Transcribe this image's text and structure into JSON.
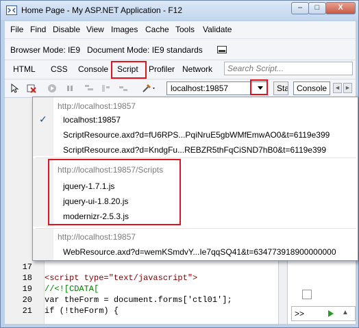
{
  "window": {
    "title": "Home Page - My ASP.NET Application - F12",
    "minimize_glyph": "–",
    "maximize_glyph": "□",
    "close_glyph": "X"
  },
  "menubar": {
    "items": [
      {
        "label": "File"
      },
      {
        "label": "Find"
      },
      {
        "label": "Disable"
      },
      {
        "label": "View"
      },
      {
        "label": "Images"
      },
      {
        "label": "Cache"
      },
      {
        "label": "Tools"
      },
      {
        "label": "Validate"
      }
    ]
  },
  "modebar": {
    "browser_mode": "Browser Mode: IE9",
    "document_mode": "Document Mode: IE9 standards"
  },
  "tabs": {
    "items": [
      {
        "label": "HTML"
      },
      {
        "label": "CSS"
      },
      {
        "label": "Console"
      },
      {
        "label": "Script"
      },
      {
        "label": "Profiler"
      },
      {
        "label": "Network"
      }
    ],
    "selected": "Script",
    "search_placeholder": "Search Script..."
  },
  "toolbar": {
    "url_value": "localhost:19857",
    "start_label": "Start",
    "console_label": "Console",
    "left_arrow": "◄",
    "right_arrow": "►"
  },
  "dropdown": {
    "groups": [
      {
        "header": "http://localhost:19857",
        "items": [
          "localhost:19857",
          "ScriptResource.axd?d=fU6RPS...PqiNruE5gbWMfEmwAO0&t=6119e399",
          "ScriptResource.axd?d=KndgFu...REBZR5thFqCiSND7hB0&t=6119e399"
        ]
      },
      {
        "header": "http://localhost:19857/Scripts",
        "items": [
          "jquery-1.7.1.js",
          "jquery-ui-1.8.20.js",
          "modernizr-2.5.3.js"
        ]
      },
      {
        "header": "http://localhost:19857",
        "items": [
          "WebResource.axd?d=wemKSmdvY...Ie7qqSQ41&t=634773918900000000"
        ]
      }
    ],
    "checked_item": "localhost:19857"
  },
  "code": {
    "lines": [
      {
        "num": "17",
        "text": ""
      },
      {
        "num": "18",
        "text": "<script type=\"text/javascript\">"
      },
      {
        "num": "19",
        "text": "//<![CDATA["
      },
      {
        "num": "20",
        "text": "var theForm = document.forms['ctl01'];"
      },
      {
        "num": "21",
        "text": "if (!theForm) {"
      }
    ]
  },
  "console": {
    "prompt": ">>"
  }
}
